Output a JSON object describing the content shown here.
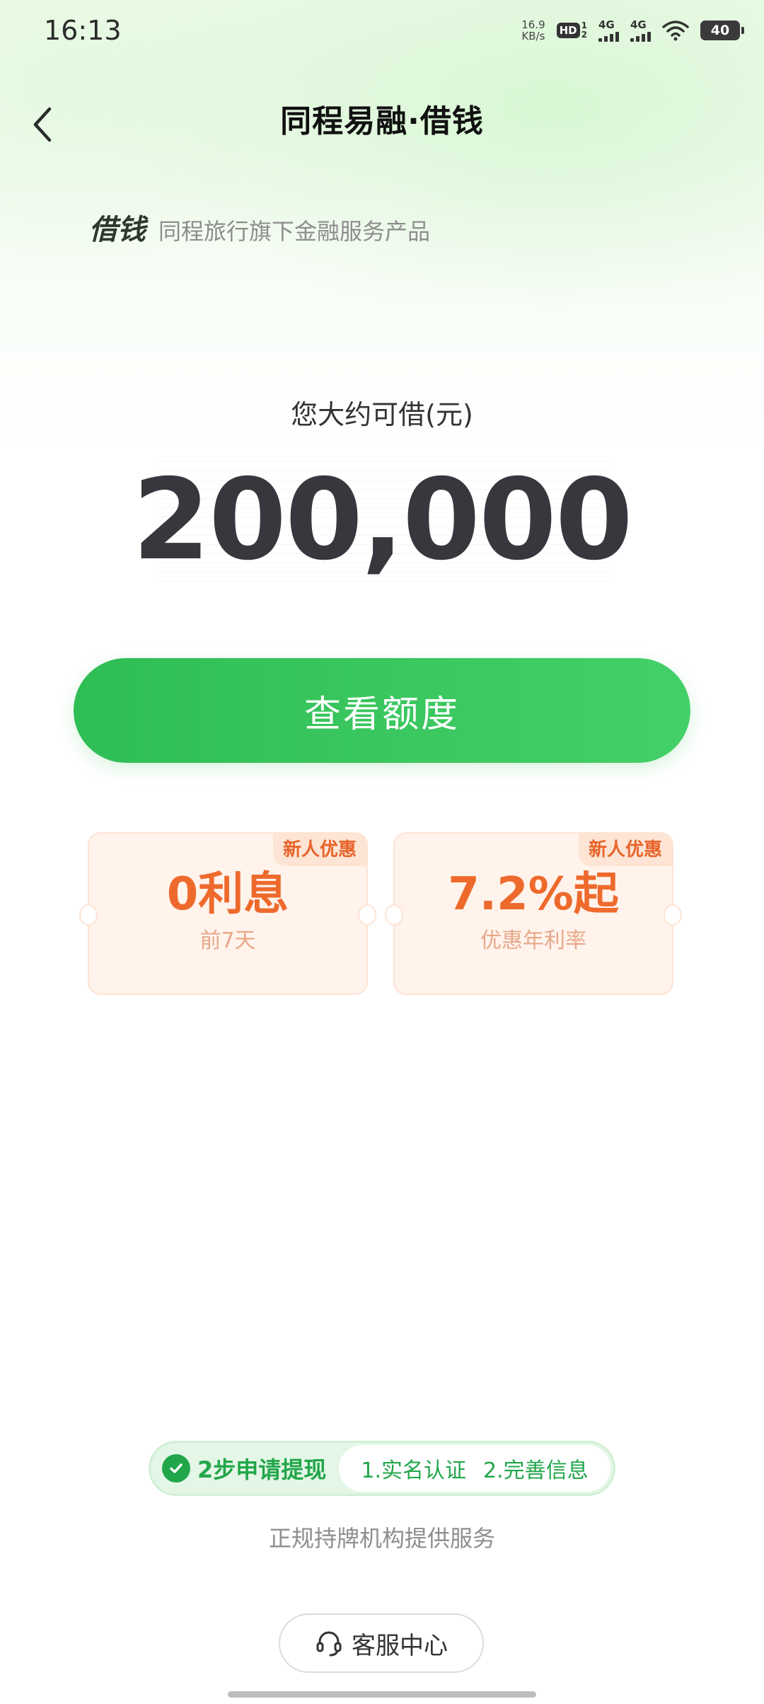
{
  "status_bar": {
    "time": "16:13",
    "net_speed_value": "16.9",
    "net_speed_unit": "KB/s",
    "hd_label": "HD",
    "hd_sub_top": "1",
    "hd_sub_bottom": "2",
    "signal1_label": "4G",
    "signal2_label": "4G",
    "battery": "40"
  },
  "header": {
    "title": "同程易融·借钱",
    "back_icon": "chevron-left-icon"
  },
  "brand": {
    "name": "借钱",
    "description": "同程旅行旗下金融服务产品"
  },
  "amount": {
    "label": "您大约可借(元)",
    "value": "200,000"
  },
  "cta": {
    "label": "查看额度",
    "color": "#2fbd55"
  },
  "coupons": [
    {
      "tag": "新人优惠",
      "headline": "0利息",
      "subtext": "前7天"
    },
    {
      "tag": "新人优惠",
      "headline": "7.2%起",
      "subtext": "优惠年利率"
    }
  ],
  "steps": {
    "summary": "2步申请提现",
    "step1": "1.实名认证",
    "step2": "2.完善信息",
    "icon": "check-circle-icon"
  },
  "service_note": "正规持牌机构提供服务",
  "support": {
    "label": "客服中心",
    "icon": "headset-icon"
  }
}
